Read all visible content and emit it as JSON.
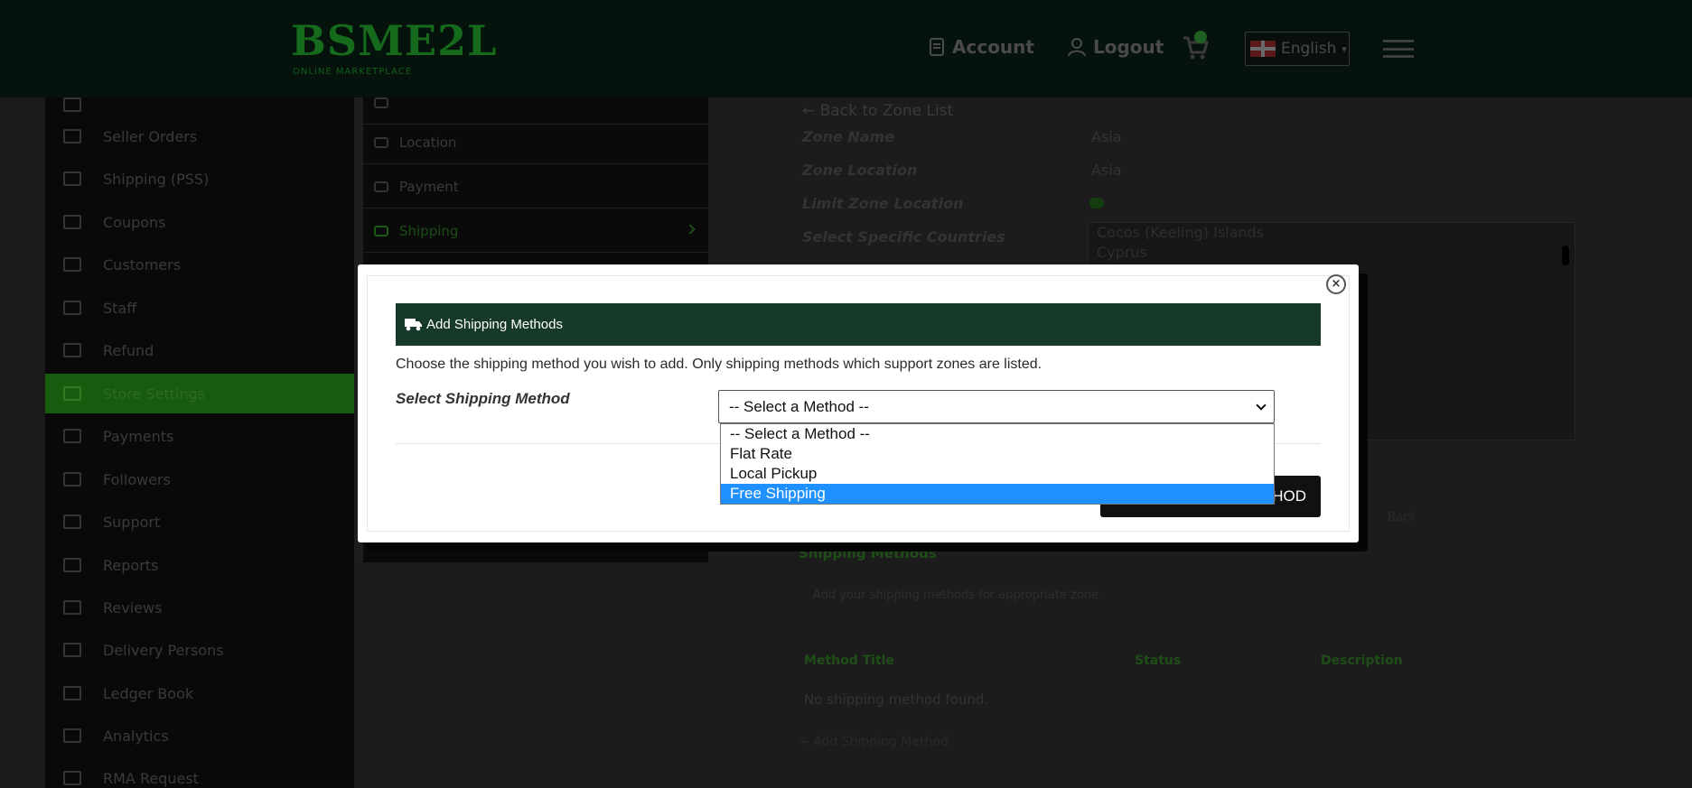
{
  "header": {
    "logo": "BSME2L",
    "logo_tagline": "ONLINE MARKETPLACE",
    "account_label": "Account",
    "logout_label": "Logout",
    "language": "English"
  },
  "sidebar": {
    "items": [
      {
        "label": "Seller Orders",
        "icon": "cart-icon"
      },
      {
        "label": "Shipping (PSS)",
        "icon": "truck-icon"
      },
      {
        "label": "Coupons",
        "icon": "ticket-icon"
      },
      {
        "label": "Customers",
        "icon": "user-circle-icon"
      },
      {
        "label": "Staff",
        "icon": "user-icon"
      },
      {
        "label": "Refund",
        "icon": "refund-icon"
      },
      {
        "label": "Store Settings",
        "icon": "settings-icon",
        "active": true
      },
      {
        "label": "Payments",
        "icon": "credit-card-icon"
      },
      {
        "label": "Followers",
        "icon": "followers-icon"
      },
      {
        "label": "Support",
        "icon": "support-icon"
      },
      {
        "label": "Reports",
        "icon": "chart-icon"
      },
      {
        "label": "Reviews",
        "icon": "comment-icon"
      },
      {
        "label": "Delivery Persons",
        "icon": "delivery-icon"
      },
      {
        "label": "Ledger Book",
        "icon": "money-icon"
      },
      {
        "label": "Analytics",
        "icon": "analytics-icon"
      },
      {
        "label": "RMA Request",
        "icon": "return-icon"
      }
    ]
  },
  "submenu": {
    "items": [
      {
        "label": "Location",
        "icon": "globe-icon"
      },
      {
        "label": "Payment",
        "icon": "card-icon"
      },
      {
        "label": "Shipping",
        "icon": "truck-icon",
        "active": true
      }
    ]
  },
  "zone": {
    "back_link": "← Back to Zone List",
    "fields": [
      {
        "label": "Zone Name",
        "value": "Asia"
      },
      {
        "label": "Zone Location",
        "value": "Asia"
      },
      {
        "label": "Limit Zone Location",
        "value": ""
      },
      {
        "label": "Select Specific Countries",
        "value": "Cocos (Keeling) Islands"
      }
    ],
    "countries_extra": "Cyprus",
    "back_small": "Back",
    "shipping_methods_heading": "Shipping Methods",
    "hint": "Add your shipping methods for appropriate zone.",
    "columns": [
      "Method Title",
      "Status",
      "Description"
    ],
    "no_methods": "No shipping method found.",
    "add_link": "+ Add Shipping Method"
  },
  "modal": {
    "title": "Add Shipping Methods",
    "description": "Choose the shipping method you wish to add. Only shipping methods which support zones are listed.",
    "select_label": "Select Shipping Method",
    "select_value": "-- Select a Method --",
    "options": [
      "-- Select a Method --",
      "Flat Rate",
      "Local Pickup",
      "Free Shipping"
    ],
    "highlighted_option": "Free Shipping",
    "add_button": "ADD SHIPPING METHOD",
    "close_glyph": "×",
    "colors": {
      "header_bg": "#17392a",
      "highlight": "#1e90ff"
    }
  }
}
